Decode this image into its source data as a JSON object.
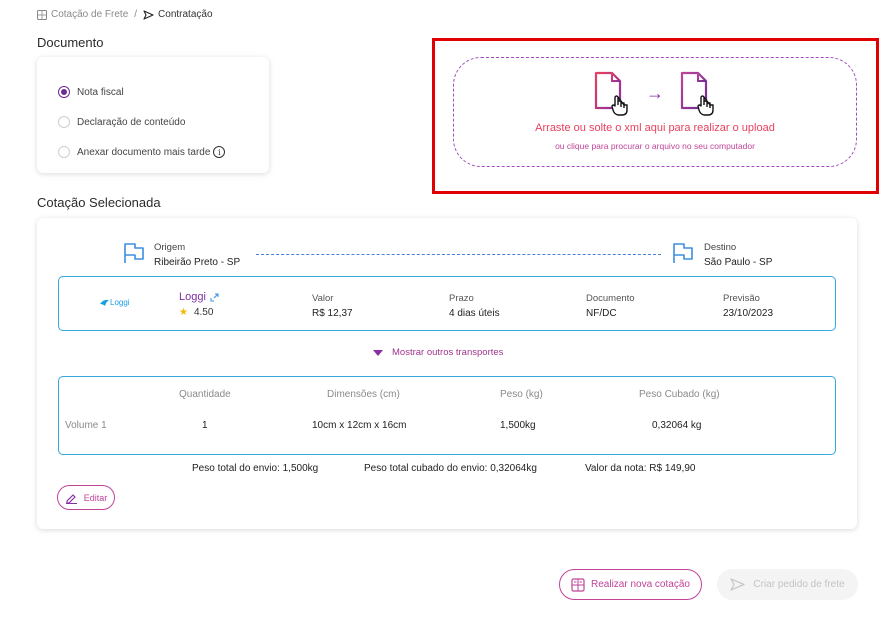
{
  "breadcrumb": {
    "items": [
      {
        "label": "Cotação de Frete",
        "icon": "calculator-icon"
      },
      {
        "label": "Contratação",
        "icon": "send-icon"
      }
    ],
    "separator": "/"
  },
  "document": {
    "title": "Documento",
    "options": [
      {
        "label": "Nota fiscal",
        "selected": true
      },
      {
        "label": "Declaração de conteúdo",
        "selected": false
      },
      {
        "label": "Anexar documento mais tarde",
        "selected": false,
        "info": "i"
      }
    ]
  },
  "upload": {
    "arrow": "→",
    "main_text": "Arraste ou solte o xml aqui para realizar o upload",
    "sub_text": "ou clique para procurar o arquivo no seu computador"
  },
  "quote": {
    "title": "Cotação Selecionada",
    "origin": {
      "label": "Origem",
      "city": "Ribeirão Preto - SP"
    },
    "destination": {
      "label": "Destino",
      "city": "São Paulo - SP"
    },
    "carrier": {
      "logo_text": "Loggi",
      "name": "Loggi",
      "rating": "4.50",
      "columns": [
        {
          "header": "Valor",
          "value": "R$ 12,37"
        },
        {
          "header": "Prazo",
          "value": "4 dias úteis"
        },
        {
          "header": "Documento",
          "value": "NF/DC"
        },
        {
          "header": "Previsão",
          "value": "23/10/2023"
        }
      ]
    },
    "more_transports": "Mostrar outros transportes",
    "volumes": {
      "headers": [
        "Quantidade",
        "Dimensões (cm)",
        "Peso (kg)",
        "Peso Cubado (kg)"
      ],
      "rows": [
        {
          "label": "Volume 1",
          "quantity": "1",
          "dimensions": "10cm x 12cm x 16cm",
          "weight": "1,500kg",
          "cubed_weight": "0,32064 kg"
        }
      ]
    },
    "totals": {
      "weight": "Peso total do envio: 1,500kg",
      "cubed": "Peso total cubado do envio: 0,32064kg",
      "invoice": "Valor da nota: R$ 149,90"
    },
    "edit_label": "Editar"
  },
  "actions": {
    "new_quote": "Realizar nova cotação",
    "create_order": "Criar pedido de frete"
  },
  "colors": {
    "accent": "#7b2fa3",
    "pink": "#c0449a",
    "blue_border": "#35a8de",
    "highlight_frame": "#e00000"
  }
}
